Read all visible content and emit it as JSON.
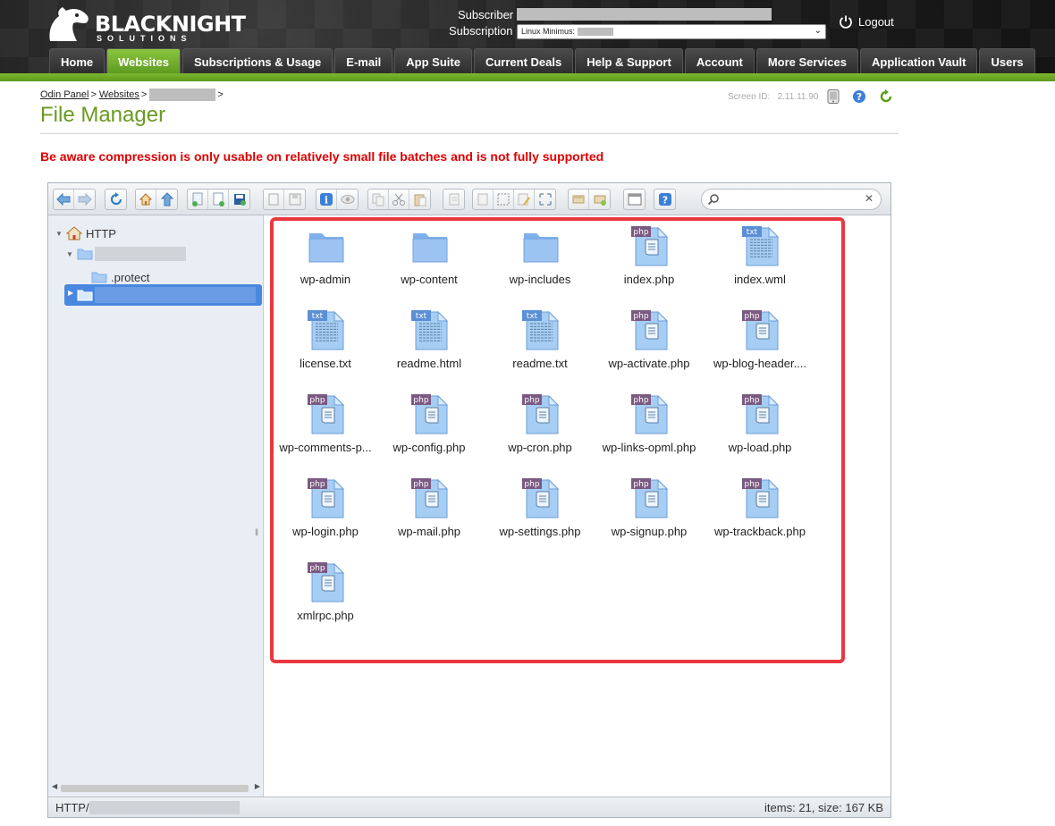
{
  "brand": {
    "name": "BLACKNIGHT",
    "tagline": "SOLUTIONS"
  },
  "account": {
    "subscriber_label": "Subscriber",
    "subscription_label": "Subscription",
    "subscription_value": "Linux Minimus:",
    "logout_label": "Logout"
  },
  "nav": {
    "tabs": [
      {
        "label": "Home",
        "active": false
      },
      {
        "label": "Websites",
        "active": true
      },
      {
        "label": "Subscriptions & Usage",
        "active": false
      },
      {
        "label": "E-mail",
        "active": false
      },
      {
        "label": "App Suite",
        "active": false
      },
      {
        "label": "Current Deals",
        "active": false
      },
      {
        "label": "Help & Support",
        "active": false
      },
      {
        "label": "Account",
        "active": false
      },
      {
        "label": "More Services",
        "active": false
      },
      {
        "label": "Application Vault",
        "active": false
      },
      {
        "label": "Users",
        "active": false
      }
    ]
  },
  "breadcrumb": {
    "items": [
      "Odin Panel",
      "Websites"
    ],
    "separator": ">"
  },
  "screen_id": {
    "label": "Screen ID:",
    "value": "2.11.11.90"
  },
  "page": {
    "title": "File Manager",
    "warning": "Be aware compression is only usable on relatively small file batches and is not fully supported"
  },
  "tree": {
    "root_label": "HTTP",
    "child_label": ".protect"
  },
  "files": [
    {
      "name": "wp-admin",
      "type": "folder"
    },
    {
      "name": "wp-content",
      "type": "folder"
    },
    {
      "name": "wp-includes",
      "type": "folder"
    },
    {
      "name": "index.php",
      "type": "php"
    },
    {
      "name": "index.wml",
      "type": "txt"
    },
    {
      "name": "license.txt",
      "type": "txt"
    },
    {
      "name": "readme.html",
      "type": "txt"
    },
    {
      "name": "readme.txt",
      "type": "txt"
    },
    {
      "name": "wp-activate.php",
      "type": "php"
    },
    {
      "name": "wp-blog-header....",
      "type": "php"
    },
    {
      "name": "wp-comments-p...",
      "type": "php"
    },
    {
      "name": "wp-config.php",
      "type": "php"
    },
    {
      "name": "wp-cron.php",
      "type": "php"
    },
    {
      "name": "wp-links-opml.php",
      "type": "php"
    },
    {
      "name": "wp-load.php",
      "type": "php"
    },
    {
      "name": "wp-login.php",
      "type": "php"
    },
    {
      "name": "wp-mail.php",
      "type": "php"
    },
    {
      "name": "wp-settings.php",
      "type": "php"
    },
    {
      "name": "wp-signup.php",
      "type": "php"
    },
    {
      "name": "wp-trackback.php",
      "type": "php"
    },
    {
      "name": "xmlrpc.php",
      "type": "php"
    }
  ],
  "status": {
    "path_prefix": "HTTP/",
    "info": "items: 21, size: 167 KB"
  },
  "icons": {
    "toolbar": [
      "back-icon",
      "forward-icon",
      "reload-icon",
      "home-icon",
      "up-icon",
      "new-folder-icon",
      "new-file-icon",
      "upload-icon",
      "open-icon",
      "save-icon",
      "info-icon",
      "view-icon",
      "copy-icon",
      "cut-icon",
      "paste-icon",
      "duplicate-icon",
      "rename-icon",
      "select-all-icon",
      "edit-icon",
      "resize-icon",
      "archive-icon",
      "extract-icon",
      "view-mode-icon",
      "help-icon"
    ],
    "header": [
      "power-icon"
    ]
  },
  "colors": {
    "accent_green": "#6a9a1f",
    "warning_red": "#e00000",
    "highlight_red": "#e8383f",
    "selection_blue": "#4a88e0"
  }
}
